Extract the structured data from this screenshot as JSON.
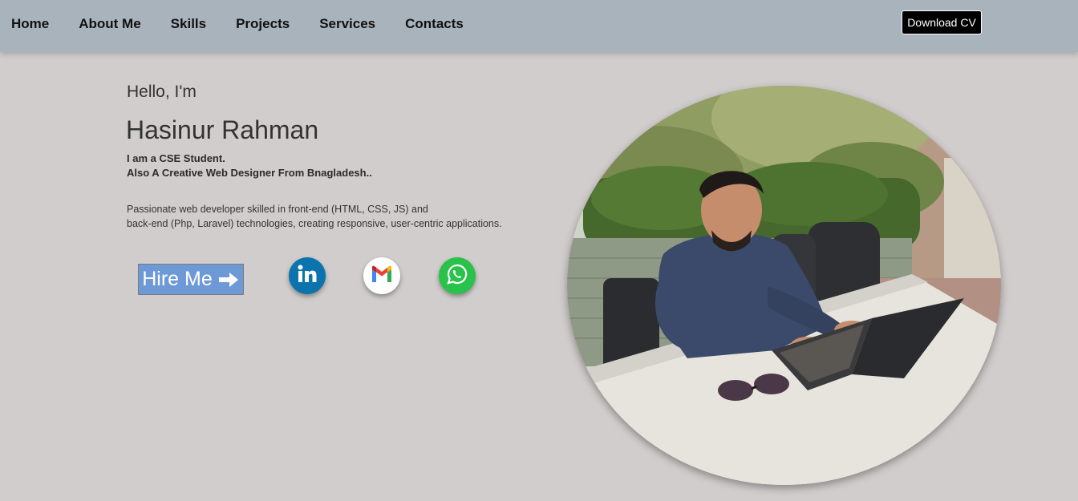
{
  "nav": {
    "items": [
      {
        "label": "Home"
      },
      {
        "label": "About Me"
      },
      {
        "label": "Skills"
      },
      {
        "label": "Projects"
      },
      {
        "label": "Services"
      },
      {
        "label": "Contacts"
      }
    ],
    "download_label": "Download CV"
  },
  "hero": {
    "greeting": "Hello, I'm",
    "name": "Hasinur Rahman",
    "tagline_1": "I am a CSE Student.",
    "tagline_2": "Also A Creative Web Designer From Bnagladesh..",
    "bio_1": "Passionate web developer skilled in front-end (HTML, CSS, JS) and",
    "bio_2": "back-end (Php, Laravel) technologies, creating responsive, user-centric applications.",
    "hire_label": "Hire Me"
  },
  "social": {
    "icons": [
      "linkedin-icon",
      "gmail-icon",
      "whatsapp-icon"
    ]
  },
  "colors": {
    "navbar": "#a9b3bc",
    "page_bg": "#d1cdcc",
    "hire_button": "#6d9ad6",
    "download_button": "#000000",
    "linkedin": "#0b73ad",
    "whatsapp": "#29c24a"
  }
}
